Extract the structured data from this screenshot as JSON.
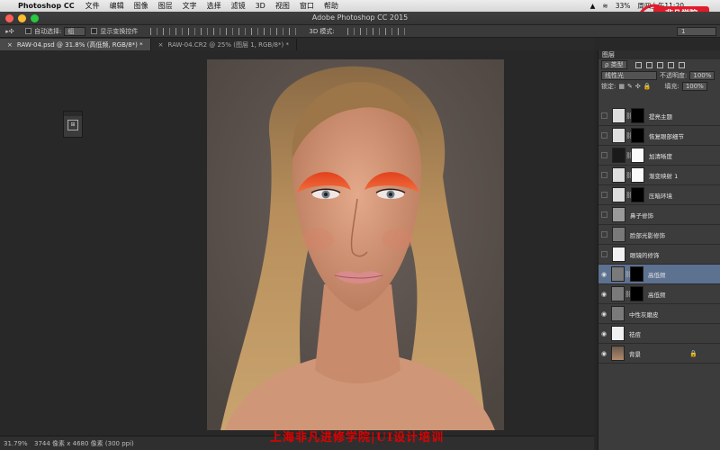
{
  "menubar": {
    "app_name": "Photoshop CC",
    "menus": [
      "文件",
      "编辑",
      "图像",
      "图层",
      "文字",
      "选择",
      "滤镜",
      "3D",
      "视图",
      "窗口",
      "帮助"
    ],
    "battery": "33%",
    "clock": "周四上午11:20"
  },
  "window": {
    "title": "Adobe Photoshop CC 2015"
  },
  "options_bar": {
    "auto_select_label": "自动选择:",
    "auto_select_value": "组",
    "show_transform_label": "显示变换控件",
    "mode_3d_label": "3D 模式:",
    "right_value": "1"
  },
  "tabs": [
    {
      "label": "RAW-04.psd @ 31.8% (高低频, RGB/8*) *"
    },
    {
      "label": "RAW-04.CR2 @ 25% (图层 1, RGB/8*) *"
    }
  ],
  "status": {
    "zoom": "31.79%",
    "doc_info": "3744 像素 x 4680 像素 (300 ppi)"
  },
  "watermark": "上海非凡进修学院|UI设计培训",
  "layers_panel": {
    "tab_label": "图层",
    "kind_filter": "类型",
    "blend_mode": "线性光",
    "opacity_label": "不透明度:",
    "opacity_value": "100%",
    "lock_label": "锁定:",
    "fill_label": "填充:",
    "fill_value": "100%",
    "layers": [
      {
        "name": "提亮主题",
        "visible": false,
        "thumb": "adj",
        "mask": "black",
        "selected": false
      },
      {
        "name": "恢复眼部细节",
        "visible": false,
        "thumb": "adj",
        "mask": "black",
        "selected": false
      },
      {
        "name": "加清晰度",
        "visible": false,
        "thumb": "dark",
        "mask": "white",
        "selected": false
      },
      {
        "name": "渐变映射 1",
        "visible": false,
        "thumb": "adj",
        "mask": "white",
        "selected": false
      },
      {
        "name": "压暗环境",
        "visible": false,
        "thumb": "adj",
        "mask": "black",
        "selected": false
      },
      {
        "name": "鼻子修饰",
        "visible": false,
        "thumb": "light",
        "mask": null,
        "selected": false
      },
      {
        "name": "脸部光影修饰",
        "visible": false,
        "thumb": "gray",
        "mask": null,
        "selected": false
      },
      {
        "name": "眼镜的修饰",
        "visible": false,
        "thumb": "white",
        "mask": null,
        "selected": false
      },
      {
        "name": "高低频",
        "visible": true,
        "thumb": "gray",
        "mask": "black",
        "selected": true
      },
      {
        "name": "高低频",
        "visible": true,
        "thumb": "gray",
        "mask": "black",
        "selected": false
      },
      {
        "name": "中性灰磨皮",
        "visible": true,
        "thumb": "gray",
        "mask": null,
        "selected": false
      },
      {
        "name": "祛痘",
        "visible": true,
        "thumb": "white",
        "mask": null,
        "selected": false
      },
      {
        "name": "背景",
        "visible": true,
        "thumb": "photo",
        "mask": null,
        "selected": false,
        "locked": true
      }
    ]
  },
  "colors": {
    "selected_layer": "#5d7190",
    "watermark": "#e00000",
    "traffic_red": "#ff5f57",
    "traffic_yellow": "#febc2e",
    "traffic_green": "#28c840"
  }
}
